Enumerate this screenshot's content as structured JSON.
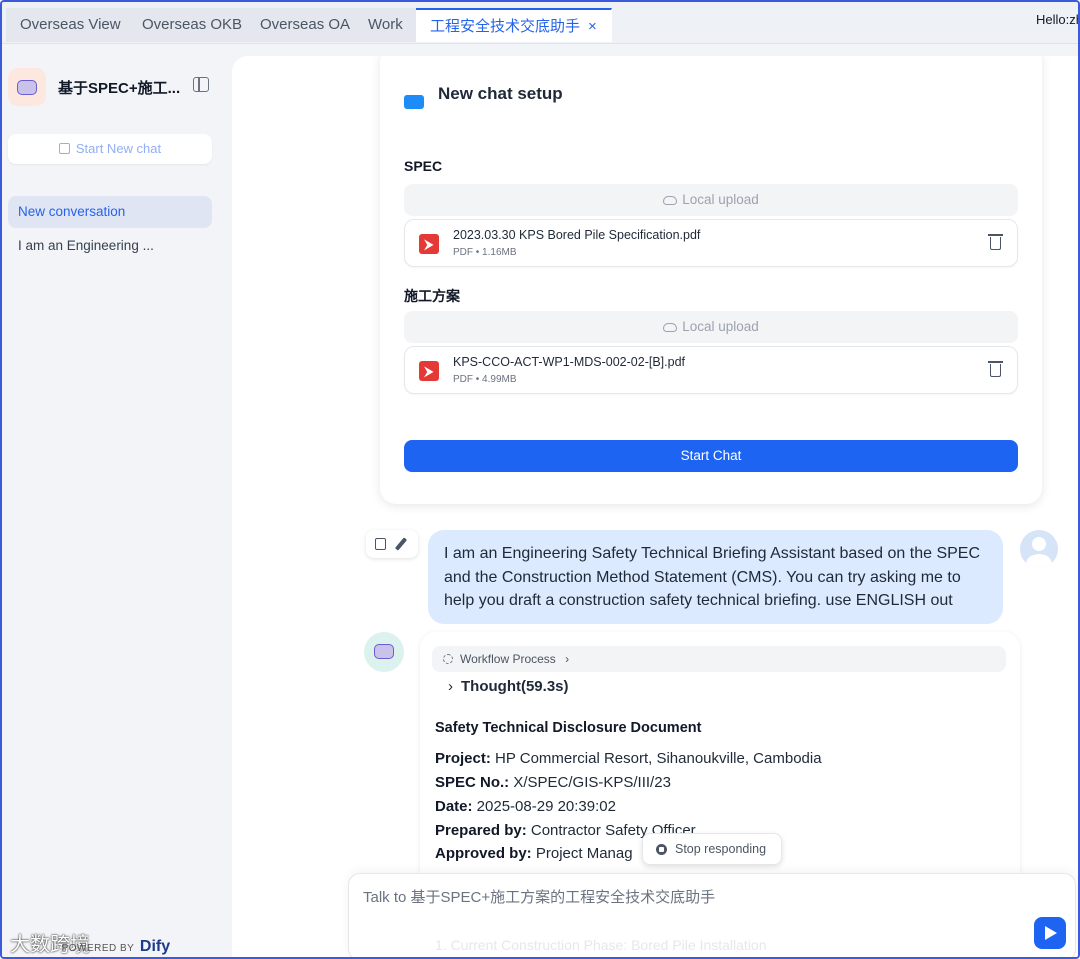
{
  "tabs": [
    {
      "label": "Overseas View"
    },
    {
      "label": "Overseas OKB"
    },
    {
      "label": "Overseas OA"
    },
    {
      "label": "Work"
    },
    {
      "label": "工程安全技术交底助手",
      "close": "×"
    }
  ],
  "header": {
    "greeting": "Hello:zh"
  },
  "sidebar": {
    "app_title": "基于SPEC+施工...",
    "new_chat_label": "Start New chat",
    "conversations": [
      {
        "label": "New conversation"
      },
      {
        "label": "I am an Engineering ..."
      }
    ],
    "brand": {
      "watermark": "大数跨境",
      "powered_by": "POWERED BY",
      "logo": "Dify"
    }
  },
  "setup": {
    "title": "New chat setup",
    "spec_label": "SPEC",
    "cms_label": "施工方案",
    "upload_label": "Local upload",
    "files": [
      {
        "name": "2023.03.30 KPS Bored Pile Specification.pdf",
        "meta": "PDF • 1.16MB"
      },
      {
        "name": "KPS-CCO-ACT-WP1-MDS-002-02-[B].pdf",
        "meta": "PDF • 4.99MB"
      }
    ],
    "start_label": "Start Chat"
  },
  "user_message": {
    "text": "I am an Engineering Safety Technical Briefing Assistant based on the SPEC and the Construction Method Statement (CMS). You can try asking me to help you draft a construction safety technical briefing. use ENGLISH out"
  },
  "bot_message": {
    "workflow_label": "Workflow Process",
    "thought_label": "Thought(59.3s)",
    "doc_title": "Safety Technical Disclosure Document",
    "fields": [
      {
        "label": "Project:",
        "value": " HP Commercial Resort, Sihanoukville, Cambodia"
      },
      {
        "label": "SPEC No.:",
        "value": " X/SPEC/GIS-KPS/III/23"
      },
      {
        "label": "Date:",
        "value": " 2025-08-29 20:39:02"
      },
      {
        "label": "Prepared by:",
        "value": " Contractor Safety Officer"
      },
      {
        "label": "Approved by:",
        "value": " Project Manag"
      }
    ],
    "trailing_line": "1. Current Construction Phase: Bored Pile Installation"
  },
  "stop_label": "Stop responding",
  "input": {
    "placeholder": "Talk to 基于SPEC+施工方案的工程安全技术交底助手"
  },
  "colors": {
    "accent": "#1d64f2",
    "user_bubble": "#dbeafe",
    "sidebar_bg": "#f2f4f7"
  }
}
